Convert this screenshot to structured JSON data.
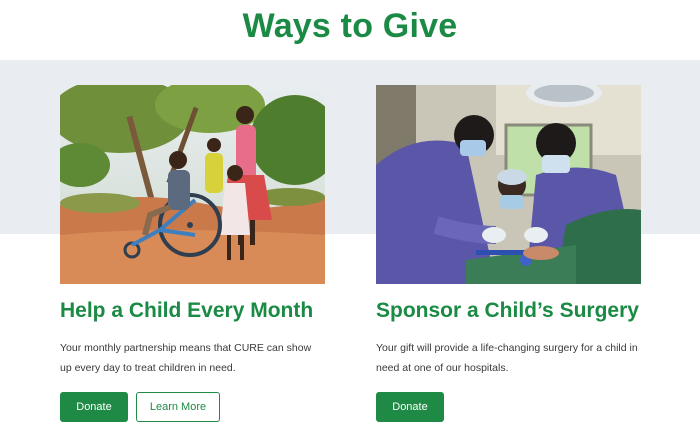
{
  "header": {
    "title": "Ways to Give"
  },
  "theme": {
    "accent": "#1a8a44",
    "band": "#e9edf1"
  },
  "cards": [
    {
      "heading": "Help a Child Every Month",
      "body": "Your monthly partnership means that CURE can show up every day to treat children in need.",
      "buttons": {
        "donate": "Donate",
        "learn_more": "Learn More"
      },
      "image": "photo-children-wheelchair"
    },
    {
      "heading": "Sponsor a Child’s Surgery",
      "body": "Your gift will provide a life-changing surgery for a child in need at one of our hospitals.",
      "buttons": {
        "donate": "Donate"
      },
      "image": "photo-surgeons-operating"
    }
  ]
}
